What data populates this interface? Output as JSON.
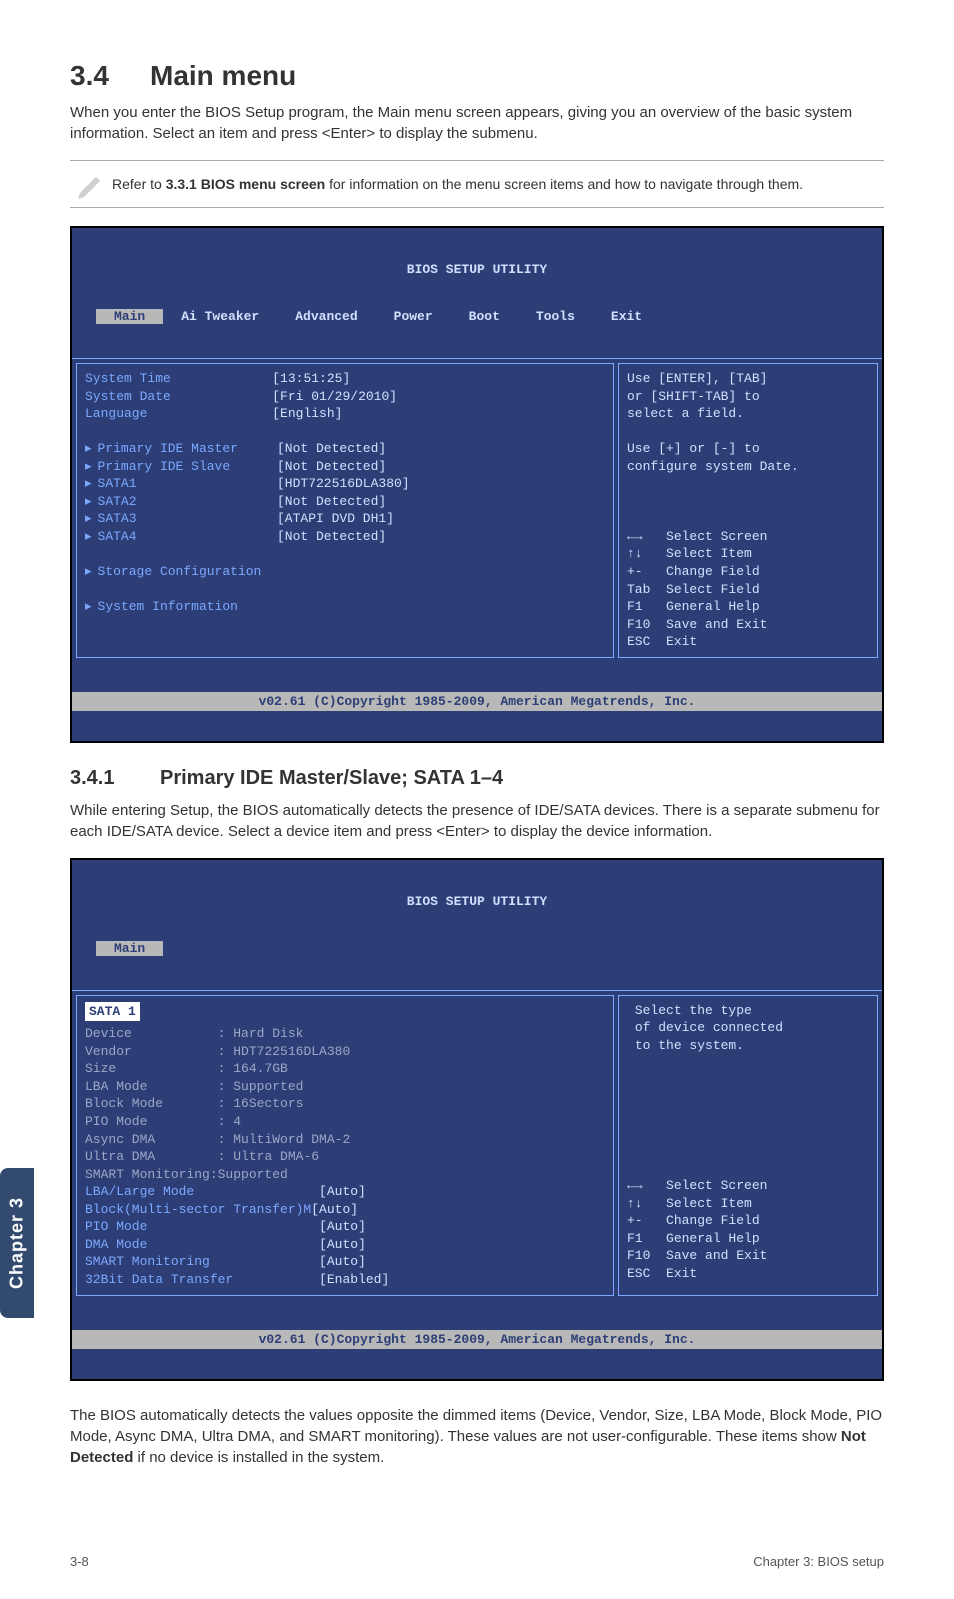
{
  "heading": {
    "num": "3.4",
    "title": "Main menu"
  },
  "intro": "When you enter the BIOS Setup program, the Main menu screen appears, giving you an overview of the basic system information. Select an item and press <Enter> to display the submenu.",
  "note": {
    "prefix": "Refer to ",
    "bold": "3.3.1 BIOS menu screen",
    "suffix": " for information on the menu screen items and how to navigate through them."
  },
  "bios1": {
    "title": "BIOS SETUP UTILITY",
    "tabs": [
      "Main",
      "Ai Tweaker",
      "Advanced",
      "Power",
      "Boot",
      "Tools",
      "Exit"
    ],
    "selectedTab": "Main",
    "rows": [
      {
        "label": "System Time",
        "value": "[13:51:25]"
      },
      {
        "label": "System Date",
        "value": "[Fri 01/29/2010]"
      },
      {
        "label": "Language",
        "value": "[English]"
      }
    ],
    "devices": [
      {
        "label": "Primary IDE Master",
        "value": "[Not Detected]"
      },
      {
        "label": "Primary IDE Slave",
        "value": "[Not Detected]"
      },
      {
        "label": "SATA1",
        "value": "[HDT722516DLA380]"
      },
      {
        "label": "SATA2",
        "value": "[Not Detected]"
      },
      {
        "label": "SATA3",
        "value": "[ATAPI DVD DH1]"
      },
      {
        "label": "SATA4",
        "value": "[Not Detected]"
      }
    ],
    "extra": [
      "Storage Configuration",
      "System Information"
    ],
    "help": {
      "top": [
        "Use [ENTER], [TAB]",
        "or [SHIFT-TAB] to",
        "select a field.",
        "",
        "Use [+] or [-] to",
        "configure system Date."
      ],
      "legend": [
        {
          "key": "←→",
          "text": "Select Screen"
        },
        {
          "key": "↑↓",
          "text": "Select Item"
        },
        {
          "key": "+-",
          "text": "Change Field"
        },
        {
          "key": "Tab",
          "text": "Select Field"
        },
        {
          "key": "F1",
          "text": "General Help"
        },
        {
          "key": "F10",
          "text": "Save and Exit"
        },
        {
          "key": "ESC",
          "text": "Exit"
        }
      ]
    },
    "footer": "v02.61 (C)Copyright 1985-2009, American Megatrends, Inc."
  },
  "subheading": {
    "num": "3.4.1",
    "title": "Primary IDE Master/Slave; SATA 1–4"
  },
  "subintro": "While entering Setup, the BIOS automatically detects the presence of IDE/SATA devices. There is a separate submenu for each IDE/SATA device. Select a device item and press <Enter> to display the device information.",
  "bios2": {
    "title": "BIOS SETUP UTILITY",
    "tabs": [
      "Main"
    ],
    "section": "SATA 1",
    "info": [
      {
        "label": "Device",
        "value": ": Hard Disk"
      },
      {
        "label": "Vendor",
        "value": ": HDT722516DLA380"
      },
      {
        "label": "Size",
        "value": ": 164.7GB"
      },
      {
        "label": "LBA Mode",
        "value": ": Supported"
      },
      {
        "label": "Block Mode",
        "value": ": 16Sectors"
      },
      {
        "label": "PIO Mode",
        "value": ": 4"
      },
      {
        "label": "Async DMA",
        "value": ": MultiWord DMA-2"
      },
      {
        "label": "Ultra DMA",
        "value": ": Ultra DMA-6"
      },
      {
        "label": "SMART Monitoring",
        "value": ":Supported"
      }
    ],
    "settings": [
      {
        "label": "LBA/Large Mode",
        "value": "[Auto]"
      },
      {
        "label": "Block(Multi-sector Transfer)M",
        "value": "[Auto]"
      },
      {
        "label": "PIO Mode",
        "value": "[Auto]"
      },
      {
        "label": "DMA Mode",
        "value": "[Auto]"
      },
      {
        "label": "SMART Monitoring",
        "value": "[Auto]"
      },
      {
        "label": "32Bit Data Transfer",
        "value": "[Enabled]"
      }
    ],
    "help": {
      "top": [
        "Select the type",
        "of device connected",
        "to the system."
      ],
      "legend": [
        {
          "key": "←→",
          "text": "Select Screen"
        },
        {
          "key": "↑↓",
          "text": "Select Item"
        },
        {
          "key": "+-",
          "text": "Change Field"
        },
        {
          "key": "F1",
          "text": "General Help"
        },
        {
          "key": "F10",
          "text": "Save and Exit"
        },
        {
          "key": "ESC",
          "text": "Exit"
        }
      ]
    },
    "footer": "v02.61 (C)Copyright 1985-2009, American Megatrends, Inc."
  },
  "closing": {
    "p1a": "The BIOS automatically detects the values opposite the dimmed items (Device, Vendor, Size, LBA Mode, Block Mode, PIO Mode, Async DMA, Ultra DMA, and SMART monitoring). These values are not user-configurable. These items show ",
    "bold": "Not Detected",
    "p1b": " if no device is installed in the system."
  },
  "chapterTab": "Chapter 3",
  "footer": {
    "left": "3-8",
    "right": "Chapter 3: BIOS setup"
  }
}
